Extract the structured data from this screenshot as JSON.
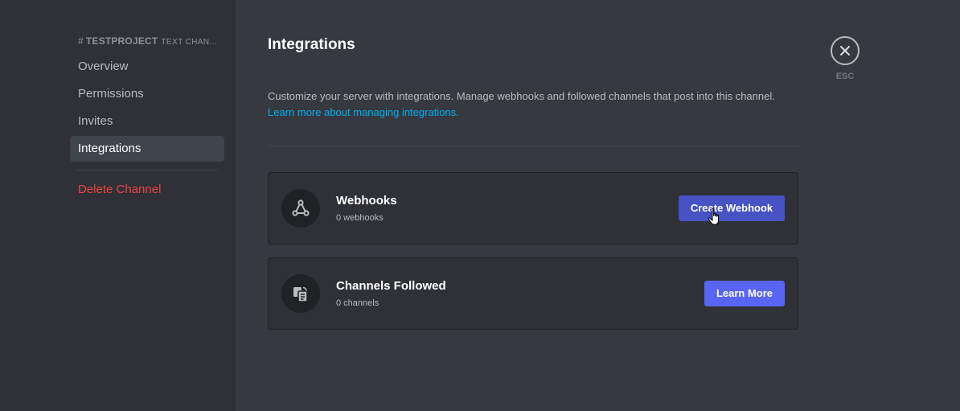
{
  "sidebar": {
    "header_hash": "#",
    "header_name": "TESTPROJECT",
    "header_sub": "TEXT CHAN...",
    "items": [
      {
        "label": "Overview"
      },
      {
        "label": "Permissions"
      },
      {
        "label": "Invites"
      },
      {
        "label": "Integrations",
        "active": true
      }
    ],
    "delete_label": "Delete Channel"
  },
  "main": {
    "title": "Integrations",
    "description": "Customize your server with integrations. Manage webhooks and followed channels that post into this channel.",
    "learn_link": "Learn more about managing integrations.",
    "cards": [
      {
        "title": "Webhooks",
        "subtitle": "0 webhooks",
        "button": "Create Webhook",
        "icon": "webhook-icon"
      },
      {
        "title": "Channels Followed",
        "subtitle": "0 channels",
        "button": "Learn More",
        "icon": "channels-followed-icon"
      }
    ]
  },
  "close": {
    "label": "ESC",
    "icon": "close-icon"
  },
  "colors": {
    "background": "#36393f",
    "sidebar": "#2f3136",
    "accent": "#5865f2",
    "accent_hover": "#4752c4",
    "danger": "#ed4245",
    "link": "#00aff4"
  }
}
